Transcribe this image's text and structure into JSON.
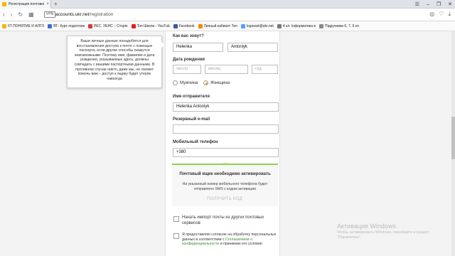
{
  "browser": {
    "tab_title": "Регистрация почтового ящ",
    "new_tab": "+",
    "window_controls": [
      "☰",
      "–",
      "❐",
      "✕"
    ],
    "vpn": "VPN",
    "url_host": "accounts.ukr.net",
    "url_path": "/registration",
    "bookmarks": [
      {
        "label": "IIT ПОНЯТИЕ И АЛГО",
        "color": "#f7b500"
      },
      {
        "label": "ВТ- Курс подготовк",
        "color": "#3b6fd8"
      },
      {
        "label": "РЕС. УЕНС :: Сторін",
        "color": "#d93b3b"
      },
      {
        "label": "Топ Школа - YouTub",
        "color": "#e02020"
      },
      {
        "label": "Facebook",
        "color": "#3b5998"
      },
      {
        "label": "Личный кабинет Тел",
        "color": "#f08a00"
      },
      {
        "label": "logosart@ukr.net",
        "color": "#4da3ff"
      },
      {
        "label": "4 кл. Інформатика в",
        "color": "#7a7a7a"
      },
      {
        "label": "Підручники 6, 7, 9 кл",
        "color": "#8a8a8a"
      }
    ]
  },
  "tooltip": {
    "text": "Ваши личные данные понадобятся для восстановления доступа к почте с помощью паспорта, если другие способы окажутся невозможными. Поэтому имя, фамилия и дата рождения, указываемые здесь, должны совпадать с вашими паспортными данными. В противном случае никто, даже мы, не сможет помочь вам – доступ к ящику будет утерян навсегда"
  },
  "form": {
    "name_label": "Как вас зовут?",
    "first_name": "Helenka",
    "last_name": "Antoniyk",
    "dob_label": "Дата рождения",
    "day_placeholder": "число",
    "month_placeholder": "месяц",
    "year_placeholder": "год",
    "gender_male": "Мужчина",
    "gender_female": "Женщина",
    "selected_gender": "female",
    "sender_label": "Имя отправителя",
    "sender_value": "Helenka Antoniyk",
    "reserve_email_label": "Резервный e-mail",
    "reserve_email_value": "",
    "phone_label": "Мобильный телефон",
    "phone_value": "+380"
  },
  "activation": {
    "title": "Почтовый ящик необходимо активировать",
    "desc": "На указанный номер мобильного телефона будет отправлено SMS с кодом активации",
    "button": "ПОЛУЧИТЬ КОД"
  },
  "checkboxes": {
    "import_text": "Начать импорт почты из других почтовых сервисов",
    "consent_prefix": "Я предоставляю согласие на обработку персональных данных в соответствии с ",
    "consent_link": "Соглашением о конфиденциальности",
    "consent_suffix": " и принимаю его условия."
  },
  "watermark": {
    "title": "Активация Windows",
    "line": "Чтобы активировать Windows, перейдите в раздел \"Параметры\"."
  }
}
